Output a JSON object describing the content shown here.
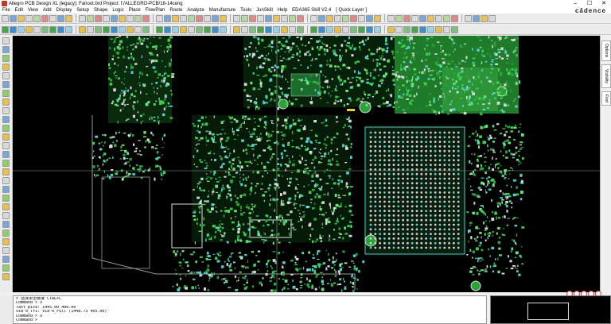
{
  "window": {
    "title": "Allegro PCB Design XL (legacy): Fanout.brd  Project: f:/ALLEGRO-PCB/18-14ceng",
    "controls": [
      "–",
      "☐",
      "✕"
    ]
  },
  "brand": "cādence",
  "menu": {
    "items": [
      "File",
      "Edit",
      "View",
      "Add",
      "Display",
      "Setup",
      "Shape",
      "Logic",
      "Place",
      "FlowPlan",
      "Route",
      "Analyze",
      "Manufacture",
      "Tools",
      "JunSkill",
      "Help",
      "EDA365 Skill V2.4",
      "[ Quick Layer ]"
    ]
  },
  "right_tabs": [
    "Options",
    "Visibility",
    "Find"
  ],
  "console": {
    "lines": [
      "> 选择单击链接 CTRL+C",
      "Command > v",
      "last pick:  1445.00 400.00",
      "Via^0_Tri: Via^0_Full (1448.73 405.00)\"",
      "Command > v",
      "Command >"
    ]
  },
  "colors": {
    "canvas": "#000000",
    "copper_green": "#1f7a2a",
    "bright_green": "#3bd14a",
    "pin_cyan": "#4fd0c8",
    "pad_white": "#d8d8d8",
    "pad_yellow": "#e6d53a",
    "outline_gray": "#9a9a9a"
  }
}
